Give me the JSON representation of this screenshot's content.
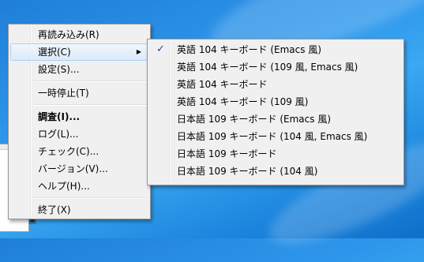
{
  "main_menu": {
    "items": [
      {
        "label": "再読み込み(R)"
      },
      {
        "label": "選択(C)"
      },
      {
        "label": "設定(S)..."
      },
      {
        "label": "一時停止(T)"
      },
      {
        "label": "調査(I)..."
      },
      {
        "label": "ログ(L)..."
      },
      {
        "label": "チェック(C)..."
      },
      {
        "label": "バージョン(V)..."
      },
      {
        "label": "ヘルプ(H)..."
      },
      {
        "label": "終了(X)"
      }
    ],
    "submenu_arrow": "▶"
  },
  "sub_menu": {
    "check_mark": "✓",
    "items": [
      {
        "label": "英語 104 キーボード (Emacs 風)",
        "checked": true
      },
      {
        "label": "英語 104 キーボード (109 風, Emacs 風)"
      },
      {
        "label": "英語 104 キーボード"
      },
      {
        "label": "英語 104 キーボード (109 風)"
      },
      {
        "label": "日本語 109 キーボード (Emacs 風)"
      },
      {
        "label": "日本語 109 キーボード (104 風, Emacs 風)"
      },
      {
        "label": "日本語 109 キーボード"
      },
      {
        "label": "日本語 109 キーボード (104 風)"
      }
    ]
  },
  "colors": {
    "menu_bg": "#f0f0f0",
    "highlight": "#dceaf8",
    "desktop": "#2d95ea"
  }
}
